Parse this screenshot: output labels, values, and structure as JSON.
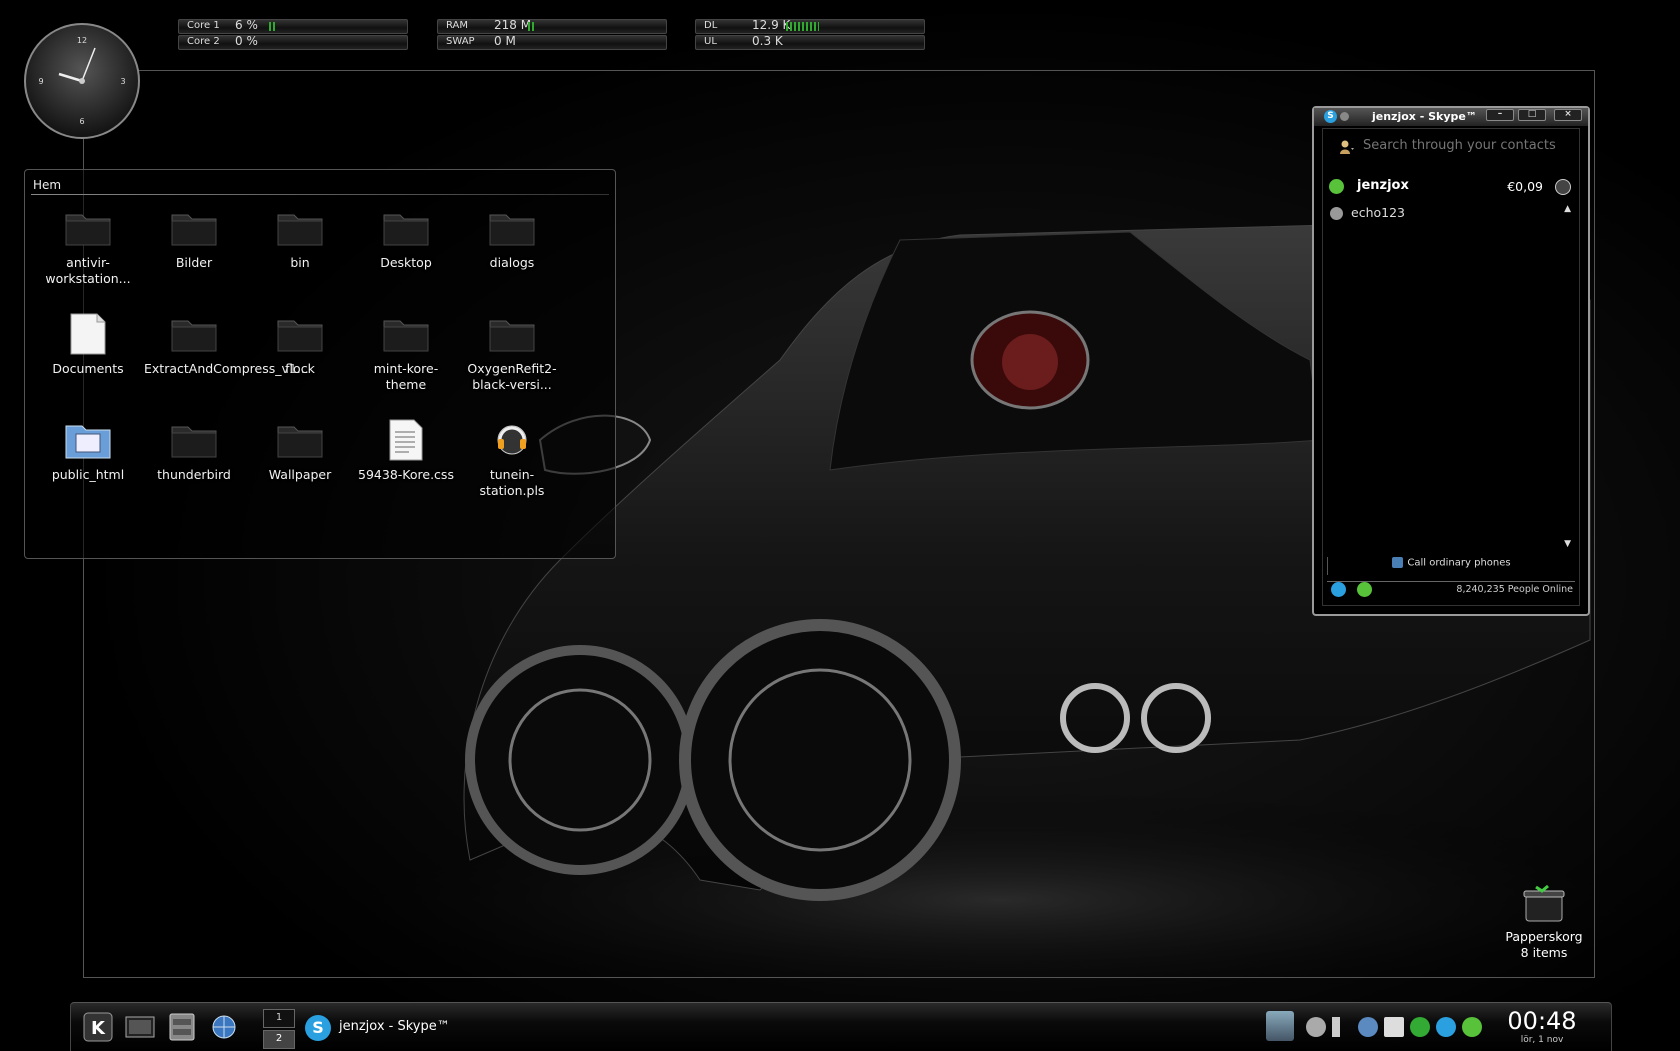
{
  "monitors": [
    {
      "rows": [
        {
          "label": "Core 1",
          "value": "6 %",
          "level": 0.06
        },
        {
          "label": "Core 2",
          "value": "0 %",
          "level": 0.0
        }
      ]
    },
    {
      "rows": [
        {
          "label": "RAM",
          "value": "218 M",
          "level": 0.05
        },
        {
          "label": "SWAP",
          "value": "0 M",
          "level": 0.0
        }
      ]
    },
    {
      "rows": [
        {
          "label": "DL",
          "value": "12.9 K",
          "level": 0.25
        },
        {
          "label": "UL",
          "value": "0.3 K",
          "level": 0.0
        }
      ]
    }
  ],
  "clock_widget": {
    "numerals": [
      "12",
      "3",
      "6",
      "9"
    ]
  },
  "folderview": {
    "title": "Hem",
    "items": [
      {
        "name": "antivir-workstation...",
        "icon": "folder-icon"
      },
      {
        "name": "Bilder",
        "icon": "folder-icon"
      },
      {
        "name": "bin",
        "icon": "folder-icon"
      },
      {
        "name": "Desktop",
        "icon": "folder-icon"
      },
      {
        "name": "dialogs",
        "icon": "folder-icon"
      },
      {
        "name": "Documents",
        "icon": "document-icon"
      },
      {
        "name": "ExtractAndCompress_v1...",
        "icon": "folder-icon"
      },
      {
        "name": "flock",
        "icon": "folder-icon"
      },
      {
        "name": "mint-kore-theme",
        "icon": "folder-icon"
      },
      {
        "name": "OxygenRefit2-black-versi...",
        "icon": "folder-icon"
      },
      {
        "name": "public_html",
        "icon": "web-folder-icon"
      },
      {
        "name": "thunderbird",
        "icon": "folder-icon"
      },
      {
        "name": "Wallpaper",
        "icon": "folder-icon"
      },
      {
        "name": "59438-Kore.css",
        "icon": "text-file-icon"
      },
      {
        "name": "tunein-station.pls",
        "icon": "audio-playlist-icon"
      }
    ]
  },
  "skype": {
    "title": "jenzjox - Skype™",
    "search_placeholder": "Search through your contacts",
    "me": {
      "name": "jenzjox",
      "credit": "€0,09"
    },
    "contacts": [
      {
        "name": "echo123"
      }
    ],
    "call_label": "Call ordinary phones",
    "online_count": "8,240,235 People Online",
    "status_color": "#58c23a"
  },
  "trash": {
    "name": "Papperskorg",
    "count": "8 items"
  },
  "taskbar": {
    "pager": [
      "1",
      "2"
    ],
    "task_label": "jenzjox - Skype™",
    "time": "00:48",
    "date": "lör, 1 nov"
  }
}
